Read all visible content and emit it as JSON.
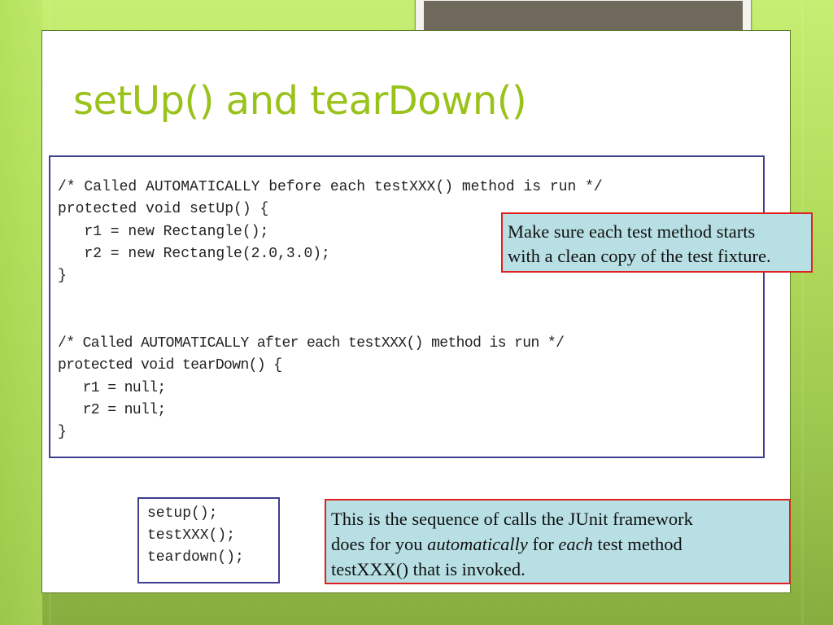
{
  "slide": {
    "title": "setUp() and tearDown()",
    "code_setup": [
      "/* Called AUTOMATICALLY before each testXXX() method is run */",
      "protected void setUp() {",
      "   r1 = new Rectangle();",
      "   r2 = new Rectangle(2.0,3.0);",
      "}"
    ],
    "code_teardown": [
      "/* Called AUTOMATICALLY after each testXXX() method is run */",
      "protected void tearDown() {",
      "   r1 = null;",
      "   r2 = null;",
      "}"
    ],
    "callout_fixture": {
      "line1": "Make sure each test method starts",
      "line2": "with a clean copy of the test fixture."
    },
    "sequence": [
      "setup();",
      "testXXX();",
      "teardown();"
    ],
    "callout_sequence": {
      "line1": "This is the sequence of calls the JUnit framework",
      "line2_a": "does for you ",
      "line2_b": "automatically",
      "line2_c": " for ",
      "line2_d": "each",
      "line2_e": " test method",
      "line3": "testXXX() that is invoked."
    }
  },
  "colors": {
    "title": "#99c21a",
    "code_border": "#3d3e8f",
    "callout_fill": "#b7dfe4",
    "callout_border": "#e01f1f",
    "background_green": "#b2dc5c"
  }
}
